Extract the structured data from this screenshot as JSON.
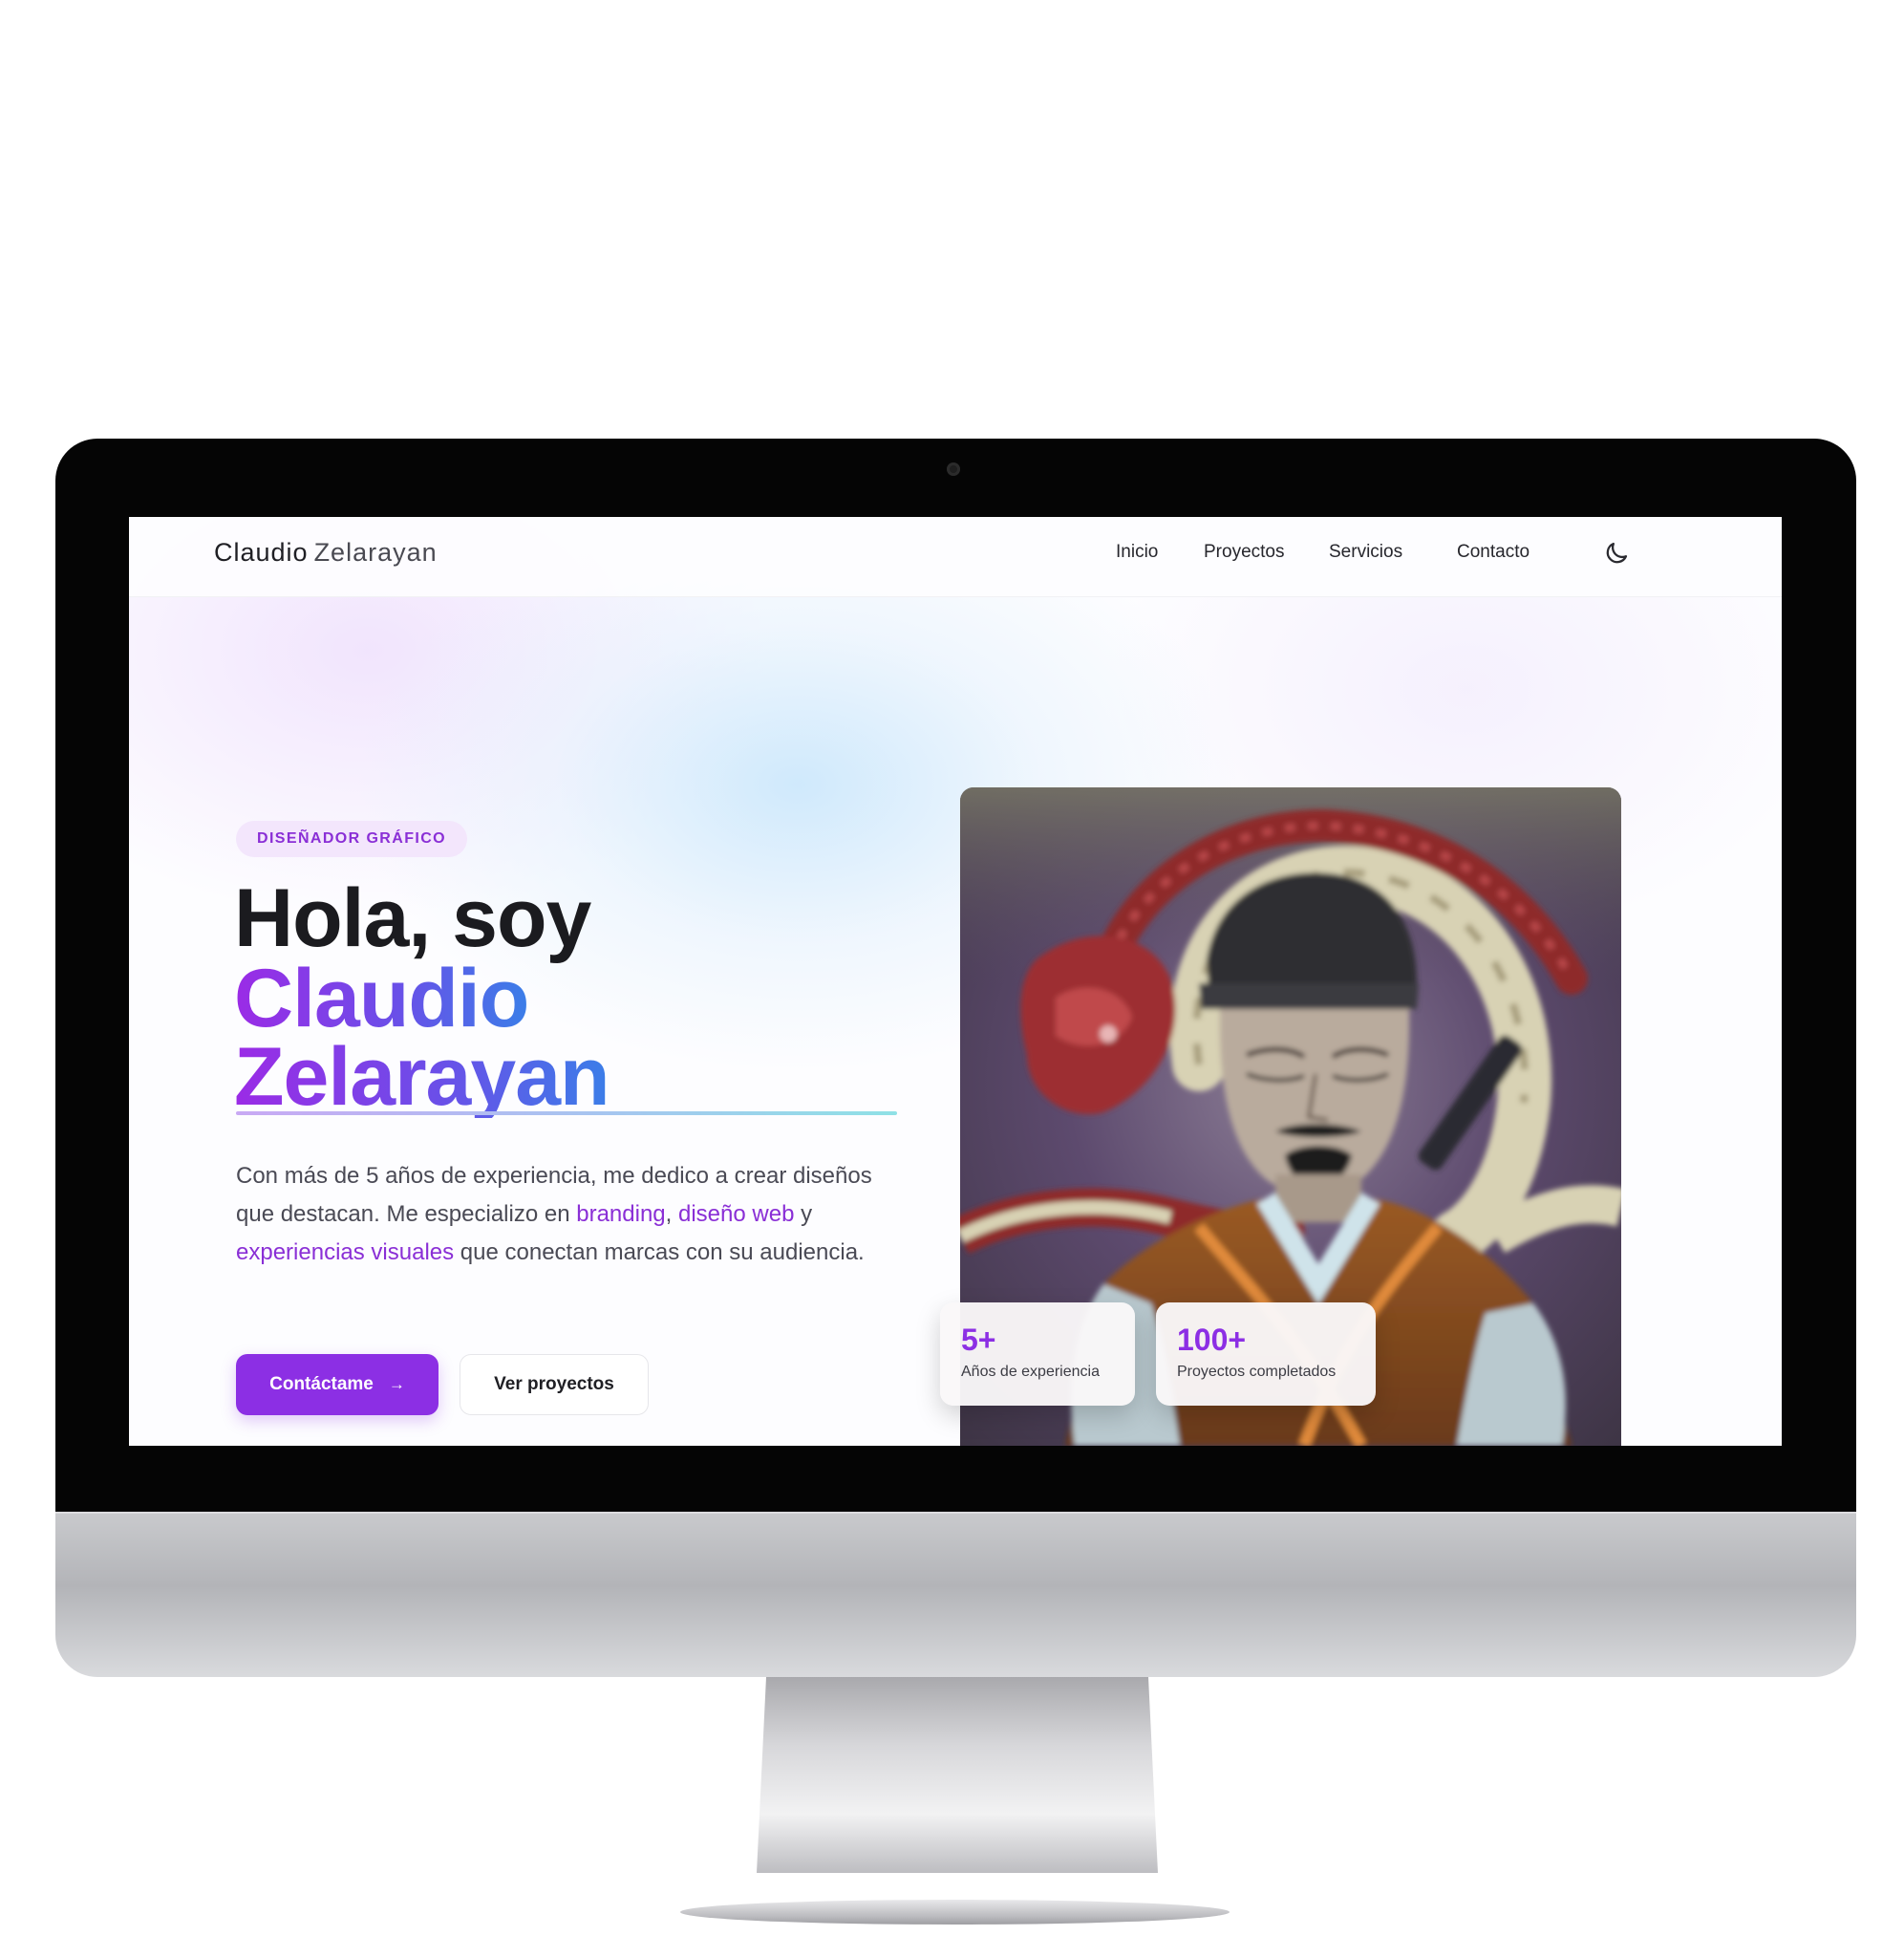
{
  "site": {
    "logo_first": "Claudio",
    "logo_last": "Zelarayan"
  },
  "nav": {
    "items": [
      {
        "label": "Inicio"
      },
      {
        "label": "Proyectos"
      },
      {
        "label": "Servicios"
      },
      {
        "label": "Contacto"
      }
    ],
    "theme_toggle_icon": "moon-icon"
  },
  "hero": {
    "badge": "DISEÑADOR GRÁFICO",
    "title_line1": "Hola, soy",
    "title_line2": "Claudio",
    "title_line3": "Zelarayan",
    "intro": {
      "part1": "Con más de 5 años de experiencia, me dedico a crear diseños que destacan. Me especializo en ",
      "hl1": "branding",
      "sep1": ", ",
      "hl2": "diseño web",
      "sep2": " y ",
      "hl3": "experiencias visuales",
      "part2": " que conectan marcas con su audiencia."
    },
    "primary_button": "Contáctame",
    "primary_button_icon": "arrow-right-icon",
    "secondary_button": "Ver proyectos"
  },
  "stats": [
    {
      "value": "5+",
      "label": "Años de experiencia"
    },
    {
      "value": "100+",
      "label": "Proyectos completados"
    }
  ],
  "colors": {
    "accent": "#8c2fe4",
    "gradient_start": "#9b2be6",
    "gradient_end": "#3b7ee8",
    "heading": "#1b1b1f",
    "bezel": "#050505"
  }
}
